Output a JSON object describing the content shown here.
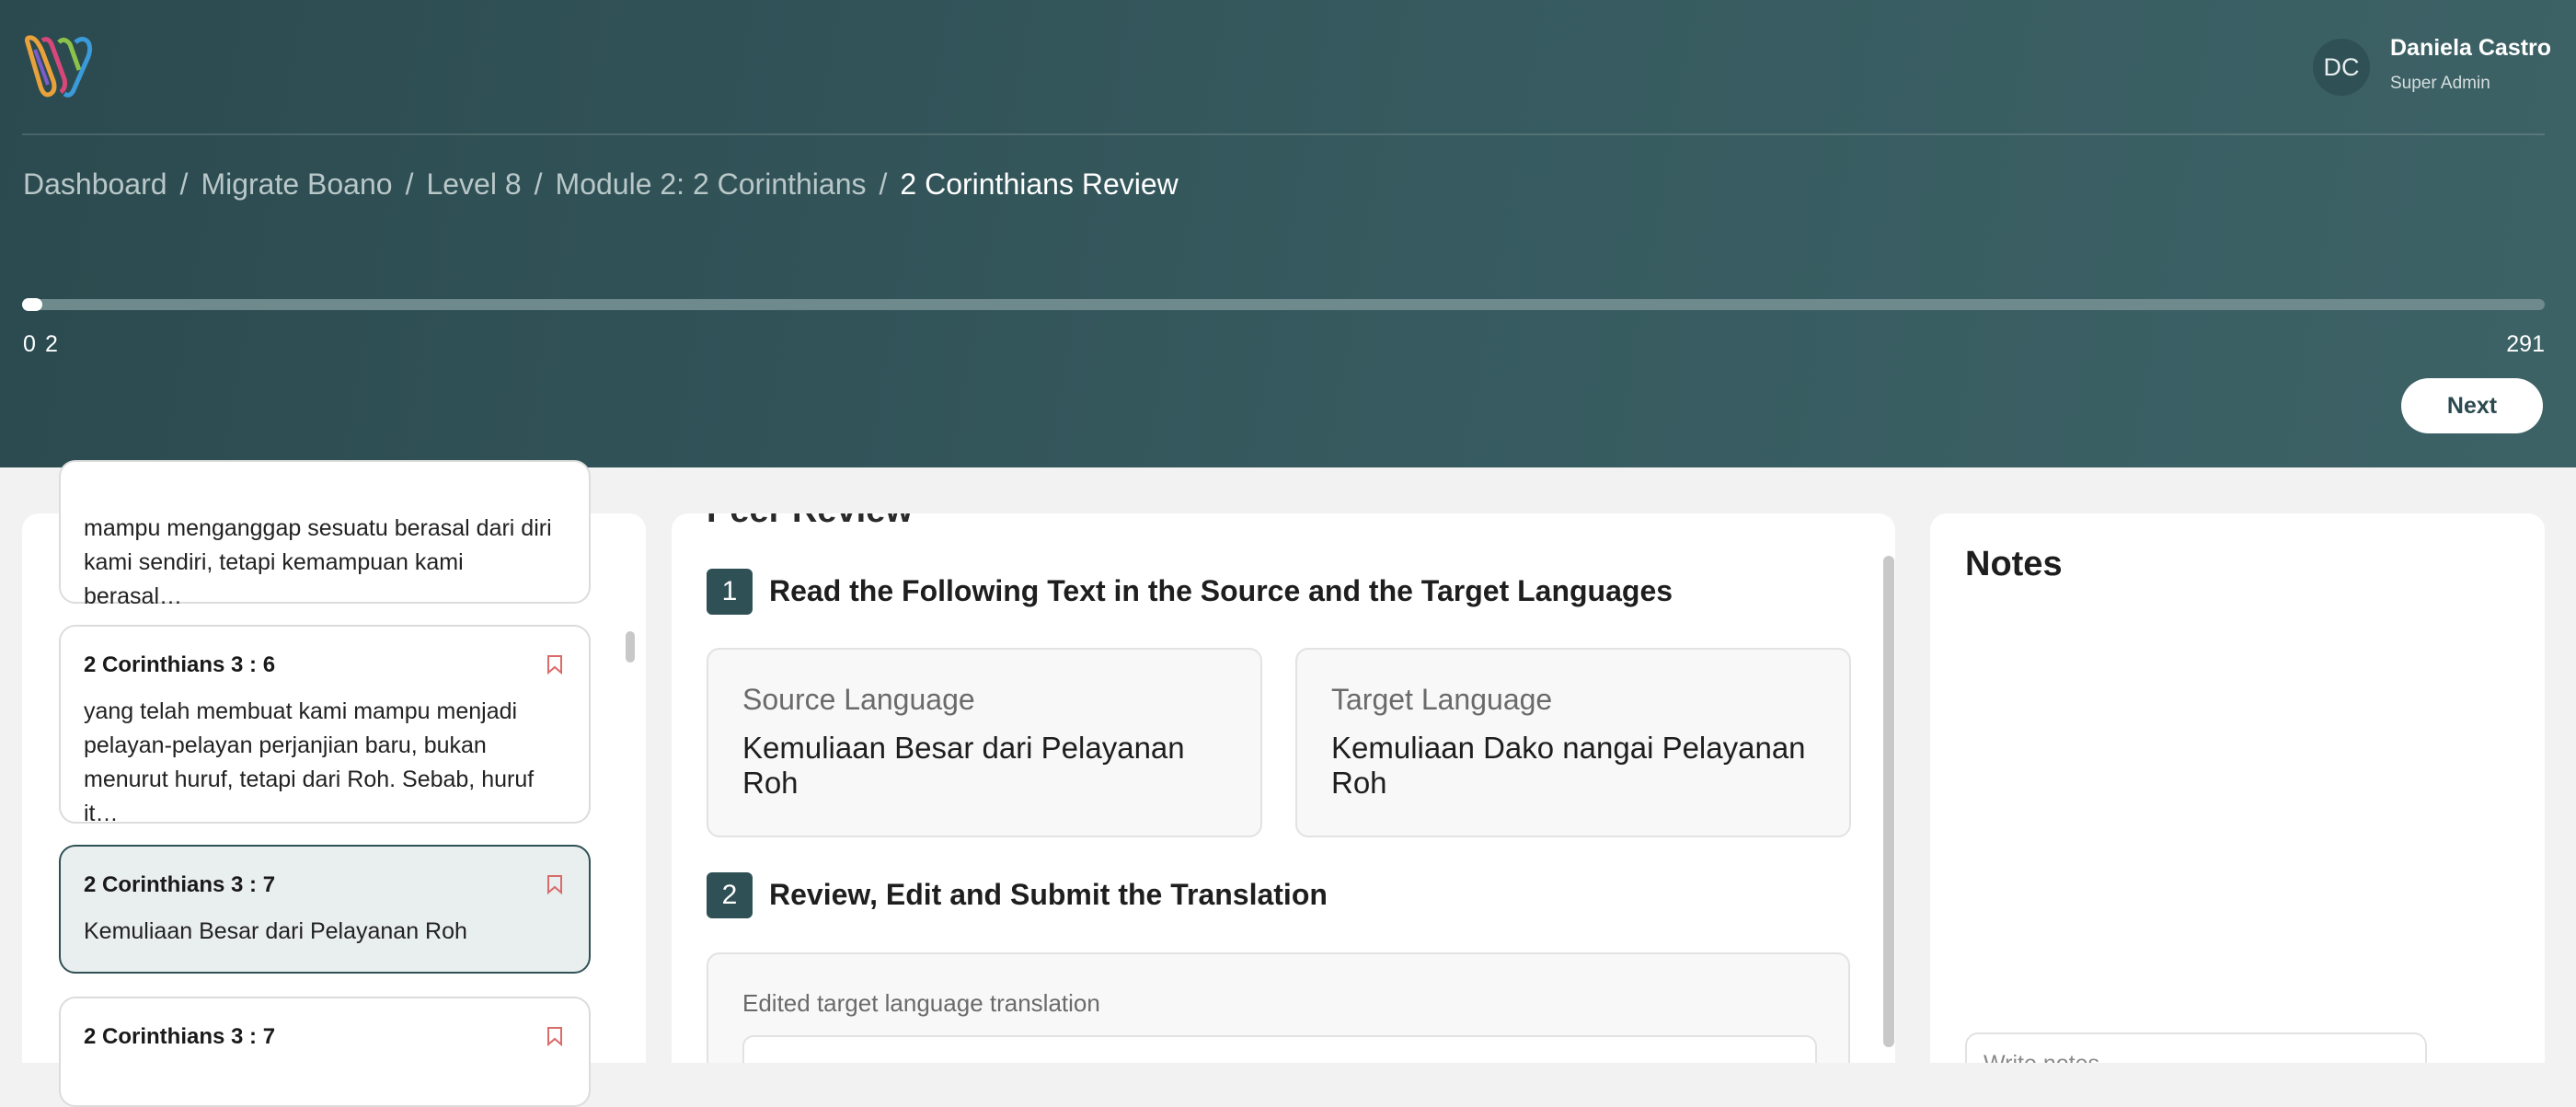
{
  "user": {
    "initials": "DC",
    "name": "Daniela Castro",
    "role": "Super Admin"
  },
  "breadcrumb": [
    {
      "label": "Dashboard"
    },
    {
      "label": "Migrate Boano"
    },
    {
      "label": "Level 8"
    },
    {
      "label": "Module 2: 2 Corinthians"
    },
    {
      "label": "2 Corinthians Review"
    }
  ],
  "breadcrumb_separator": "/",
  "progress": {
    "min": "0",
    "current": "2",
    "max": "291",
    "fraction": 0.0069
  },
  "next_label": "Next",
  "verses": [
    {
      "title": "",
      "text": "mampu menganggap sesuatu berasal dari diri kami sendiri, tetapi kemampuan kami berasal…"
    },
    {
      "title": "2 Corinthians 3 : 6",
      "text": "yang telah membuat kami mampu menjadi pelayan-pelayan perjanjian baru, bukan menurut huruf, tetapi dari Roh. Sebab, huruf it…"
    },
    {
      "title": "2 Corinthians 3 : 7",
      "text": "Kemuliaan Besar dari Pelayanan Roh"
    },
    {
      "title": "2 Corinthians 3 : 7",
      "text": ""
    }
  ],
  "review": {
    "heading": "Peer Review",
    "step1": {
      "number": "1",
      "title": "Read the Following Text in the Source and the Target Languages"
    },
    "source": {
      "label": "Source Language",
      "text": "Kemuliaan Besar dari Pelayanan Roh"
    },
    "target": {
      "label": "Target Language",
      "text": "Kemuliaan Dako nangai Pelayanan Roh"
    },
    "step2": {
      "number": "2",
      "title": "Review, Edit and Submit the Translation"
    },
    "edit_label": "Edited target language translation"
  },
  "notes": {
    "title": "Notes",
    "placeholder": "Write notes..."
  },
  "colors": {
    "header": "#2b4a4f",
    "accent": "#2f5055",
    "bookmark": "#d96b6b"
  }
}
